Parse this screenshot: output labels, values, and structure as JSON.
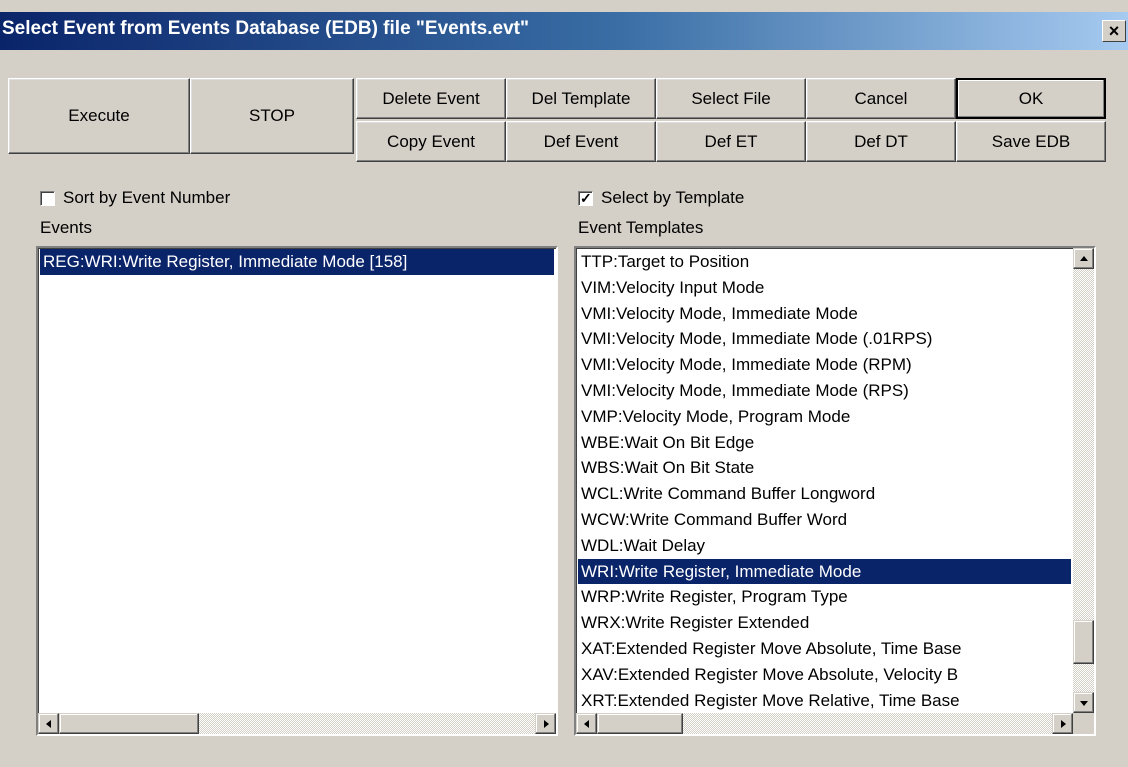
{
  "window": {
    "title": "Select Event from Events Database (EDB) file \"Events.evt\"",
    "close_glyph": "×"
  },
  "toolbar": {
    "execute": "Execute",
    "stop": "STOP",
    "delete_event": "Delete Event",
    "del_template": "Del Template",
    "select_file": "Select File",
    "cancel": "Cancel",
    "ok": "OK",
    "copy_event": "Copy Event",
    "def_event": "Def Event",
    "def_et": "Def ET",
    "def_dt": "Def DT",
    "save_edb": "Save EDB"
  },
  "events_panel": {
    "sort_checkbox_label": "Sort by Event Number",
    "sort_checked": false,
    "list_label": "Events",
    "items": [
      "REG:WRI:Write Register, Immediate Mode [158]"
    ],
    "selected_index": 0
  },
  "templates_panel": {
    "select_checkbox_label": "Select by Template",
    "select_checked": true,
    "list_label": "Event Templates",
    "items": [
      "TTP:Target to Position",
      "VIM:Velocity Input Mode",
      "VMI:Velocity Mode, Immediate Mode",
      "VMI:Velocity Mode, Immediate Mode (.01RPS)",
      "VMI:Velocity Mode, Immediate Mode (RPM)",
      "VMI:Velocity Mode, Immediate Mode (RPS)",
      "VMP:Velocity Mode, Program Mode",
      "WBE:Wait On Bit Edge",
      "WBS:Wait On Bit State",
      "WCL:Write Command Buffer Longword",
      "WCW:Write Command Buffer Word",
      "WDL:Wait Delay",
      "WRI:Write Register, Immediate Mode",
      "WRP:Write Register, Program Type",
      "WRX:Write Register Extended",
      "XAT:Extended Register Move Absolute, Time Base",
      "XAV:Extended Register Move Absolute, Velocity B",
      "XRT:Extended Register Move Relative, Time Base"
    ],
    "selected_index": 12
  }
}
